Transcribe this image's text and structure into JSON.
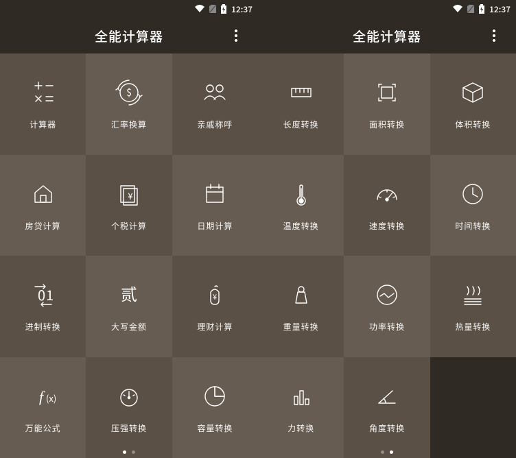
{
  "status": {
    "time": "12:37"
  },
  "appbar": {
    "title": "全能计算器"
  },
  "left": {
    "active_page": 0,
    "items": [
      {
        "icon": "calc",
        "label": "计算器"
      },
      {
        "icon": "currency",
        "label": "汇率换算"
      },
      {
        "icon": "relatives",
        "label": "亲戚称呼"
      },
      {
        "icon": "mortgage",
        "label": "房贷计算"
      },
      {
        "icon": "tax",
        "label": "个税计算"
      },
      {
        "icon": "date",
        "label": "日期计算"
      },
      {
        "icon": "base",
        "label": "进制转换"
      },
      {
        "icon": "upper",
        "label": "大写金额"
      },
      {
        "icon": "finance",
        "label": "理财计算"
      },
      {
        "icon": "formula",
        "label": "万能公式"
      },
      {
        "icon": "pressure",
        "label": "压强转换"
      },
      {
        "icon": "volume",
        "label": "容量转换"
      }
    ]
  },
  "right": {
    "active_page": 1,
    "items": [
      {
        "icon": "length",
        "label": "长度转换"
      },
      {
        "icon": "area",
        "label": "面积转换"
      },
      {
        "icon": "cube",
        "label": "体积转换"
      },
      {
        "icon": "temp",
        "label": "温度转换"
      },
      {
        "icon": "speed",
        "label": "速度转换"
      },
      {
        "icon": "time",
        "label": "时间转换"
      },
      {
        "icon": "weight",
        "label": "重量转换"
      },
      {
        "icon": "power",
        "label": "功率转换"
      },
      {
        "icon": "heat",
        "label": "热量转换"
      },
      {
        "icon": "force",
        "label": "力转换"
      },
      {
        "icon": "angle",
        "label": "角度转换"
      },
      {
        "icon": "",
        "label": ""
      }
    ]
  }
}
